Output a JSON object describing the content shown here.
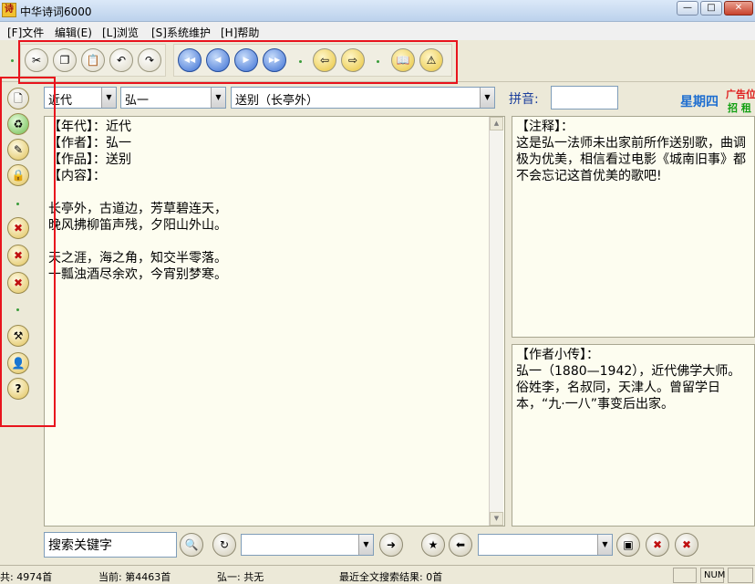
{
  "window": {
    "title": "中华诗词6000",
    "icon_glyph": "诗",
    "minimize": "—",
    "maximize": "□",
    "close": "✕"
  },
  "menu": [
    "[F]文件",
    "编辑(E)",
    "[L]浏览",
    "[S]系统维护",
    "[H]帮助"
  ],
  "toolbar_icons": {
    "edit": [
      {
        "name": "cut-icon",
        "glyph": "✂"
      },
      {
        "name": "copy-icon",
        "glyph": "❐"
      },
      {
        "name": "paste-icon",
        "glyph": "📋"
      },
      {
        "name": "undo-icon",
        "glyph": "↶"
      },
      {
        "name": "redo-icon",
        "glyph": "↷"
      }
    ],
    "nav": [
      {
        "name": "first-record-icon",
        "glyph": "◀◀"
      },
      {
        "name": "previous-record-icon",
        "glyph": "◀"
      },
      {
        "name": "next-record-icon",
        "glyph": "▶"
      },
      {
        "name": "last-record-icon",
        "glyph": "▶▶"
      }
    ],
    "history": [
      {
        "name": "back-arrow-icon",
        "glyph": "⇦"
      },
      {
        "name": "forward-arrow-icon",
        "glyph": "⇨"
      }
    ],
    "extra": [
      {
        "name": "book-icon",
        "glyph": "📖"
      },
      {
        "name": "warning-icon",
        "glyph": "⚠"
      }
    ]
  },
  "side_icons": [
    {
      "name": "new-document-icon",
      "glyph": "🗋"
    },
    {
      "name": "recycle-icon",
      "glyph": "♻"
    },
    {
      "name": "pencil-edit-icon",
      "glyph": "✎"
    },
    {
      "name": "lock-icon",
      "glyph": "🔒"
    },
    {
      "name": "cancel-image-icon",
      "glyph": "✖"
    },
    {
      "name": "cancel-edit-icon",
      "glyph": "✖"
    },
    {
      "name": "cancel-pencil-icon",
      "glyph": "✖"
    },
    {
      "name": "tools-icon",
      "glyph": "⚒"
    },
    {
      "name": "user-icon",
      "glyph": "👤"
    },
    {
      "name": "help-icon",
      "glyph": "?"
    }
  ],
  "selectors": {
    "era": "近代",
    "author": "弘一",
    "poem": "送别（长亭外）",
    "pinyin_label": "拼音:",
    "pinyin_value": ""
  },
  "ad": {
    "text1": "星期四",
    "text2": "广告位",
    "text3": "招 租"
  },
  "poem_panel": "【年代】：近代\n【作者】：弘一\n【作品】：送别\n【内容】：\n\n长亭外，古道边，芳草碧连天，\n晚风拂柳笛声残，夕阳山外山。\n\n天之涯，海之角，知交半零落。\n一瓢浊酒尽余欢，今宵别梦寒。",
  "notes_panel": "【注释】：\n这是弘一法师未出家前所作送别歌，曲调极为优美，相信看过电影《城南旧事》都不会忘记这首优美的歌吧!",
  "bio_panel": "【作者小传】：\n弘一（1880—1942），近代佛学大师。俗姓李，名叔同，天津人。曾留学日本，“九·一八”事变后出家。",
  "search": {
    "placeholder": "搜索关键字",
    "combo1": "",
    "combo2": ""
  },
  "bottom_icons": [
    {
      "name": "search-icon",
      "glyph": "🔍"
    },
    {
      "name": "refresh-search-icon",
      "glyph": "↻"
    },
    {
      "name": "search-go-icon",
      "glyph": "➜"
    },
    {
      "name": "bookmark-add-icon",
      "glyph": "★"
    },
    {
      "name": "bookmark-open-icon",
      "glyph": "⬅"
    },
    {
      "name": "folder-icon",
      "glyph": "▣"
    },
    {
      "name": "folder-delete-icon",
      "glyph": "✖"
    },
    {
      "name": "folder-clear-icon",
      "glyph": "✖"
    }
  ],
  "status": {
    "total": "共: 4974首",
    "current": "当前: 第4463首",
    "author_count": "弘一: 共无",
    "search_result": "最近全文搜索结果: 0首",
    "num": "NUM"
  }
}
